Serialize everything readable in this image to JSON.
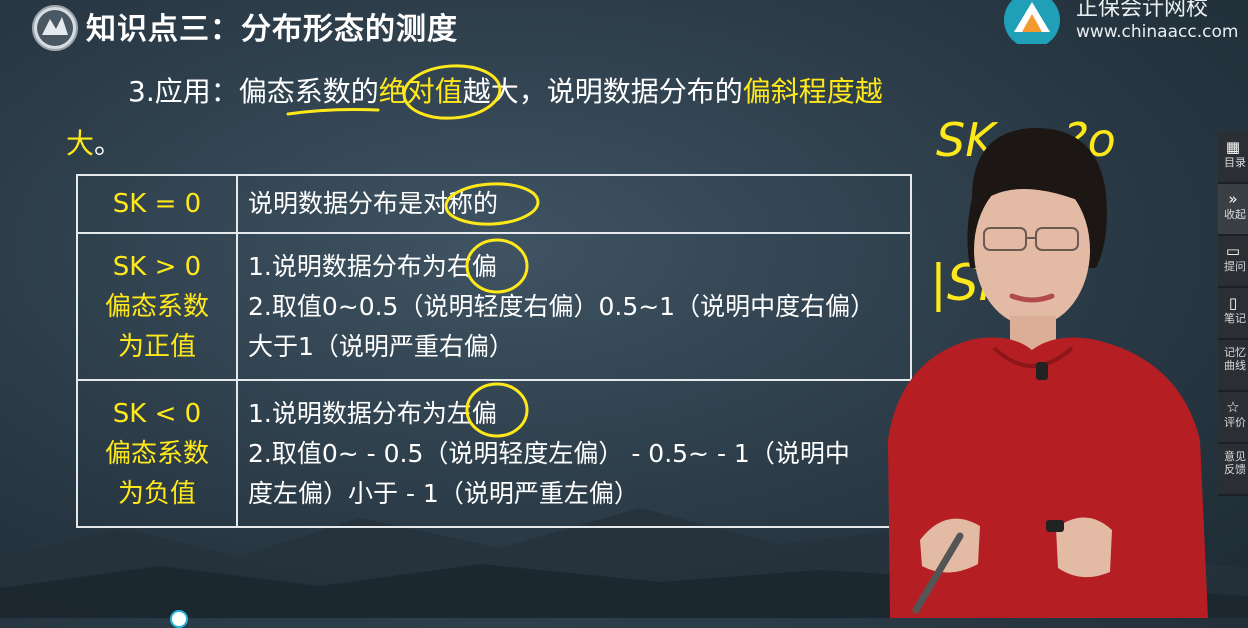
{
  "slide": {
    "title": "知识点三：分布形态的测度",
    "intro_parts": [
      {
        "text": "3.应用：偏态系数的",
        "highlight": false
      },
      {
        "text": "绝对值",
        "highlight": true
      },
      {
        "text": "越大，说明数据分布的",
        "highlight": false
      },
      {
        "text": "偏斜程度越大",
        "highlight": true
      },
      {
        "text": "。",
        "highlight": false
      }
    ],
    "table": {
      "rows": [
        {
          "condition": "SK = 0",
          "condition_sub": [
            "",
            ""
          ],
          "lines": [
            "说明数据分布是对称的"
          ]
        },
        {
          "condition": "SK > 0",
          "condition_sub": [
            "偏态系数",
            "为正值"
          ],
          "lines": [
            "1.说明数据分布为右偏",
            "2.取值0~0.5（说明轻度右偏）0.5~1（说明中度右偏）",
            "大于1（说明严重右偏）"
          ]
        },
        {
          "condition": "SK < 0",
          "condition_sub": [
            "偏态系数",
            "为负值"
          ],
          "lines": [
            "1.说明数据分布为左偏",
            "2.取值0~ - 0.5（说明轻度左偏） - 0.5~ - 1（说明中",
            "度左偏）小于 - 1（说明严重左偏）"
          ]
        }
      ]
    }
  },
  "brand": {
    "name": "正保会计网校",
    "url": "www.chinaacc.com"
  },
  "handwriting": {
    "line1": "SK < ?o",
    "line2": "|SK|"
  },
  "sidebar": {
    "items": [
      {
        "icon": "grid",
        "label": "目录"
      },
      {
        "icon": "double-chevron",
        "label": "收起"
      },
      {
        "icon": "chat",
        "label": "提问"
      },
      {
        "icon": "note",
        "label": "笔记"
      },
      {
        "icon": "",
        "label": "记忆曲线"
      },
      {
        "icon": "star",
        "label": "评价"
      },
      {
        "icon": "",
        "label": "意见反馈"
      }
    ]
  },
  "colors": {
    "highlight": "#ffe81a",
    "background": "#2e3e4a",
    "brand_teal": "#1f9fb8"
  }
}
